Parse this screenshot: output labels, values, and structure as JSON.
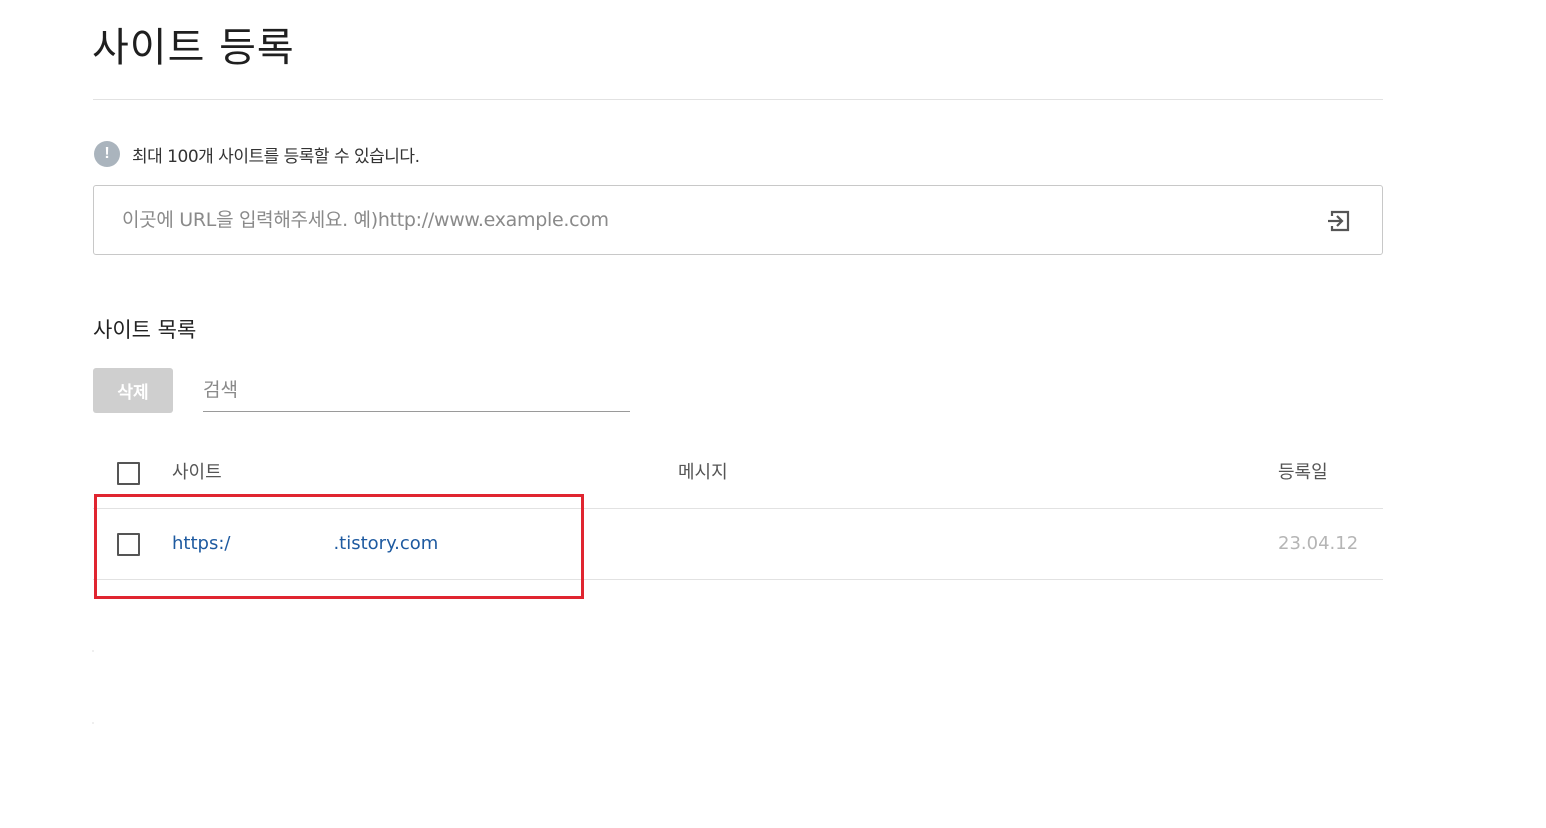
{
  "page": {
    "title": "사이트 등록"
  },
  "notice": {
    "icon": "exclamation-icon",
    "icon_glyph": "!",
    "text": "최대 100개 사이트를 등록할 수 있습니다."
  },
  "url_input": {
    "value": "",
    "placeholder": "이곳에 URL을 입력해주세요. 예)http://www.example.com",
    "submit_icon": "enter-arrow-icon"
  },
  "site_list": {
    "title": "사이트 목록",
    "delete_label": "삭제",
    "search_placeholder": "검색",
    "columns": [
      "사이트",
      "메시지",
      "등록일"
    ],
    "rows": [
      {
        "checked": false,
        "site": "https:/                  .tistory.com",
        "message": "",
        "date": "23.04.12"
      }
    ]
  },
  "colors": {
    "link": "#1e5aa0",
    "highlight": "#e02530",
    "disabled_button": "#cfcfcf",
    "date_text": "#b5b5b5"
  }
}
